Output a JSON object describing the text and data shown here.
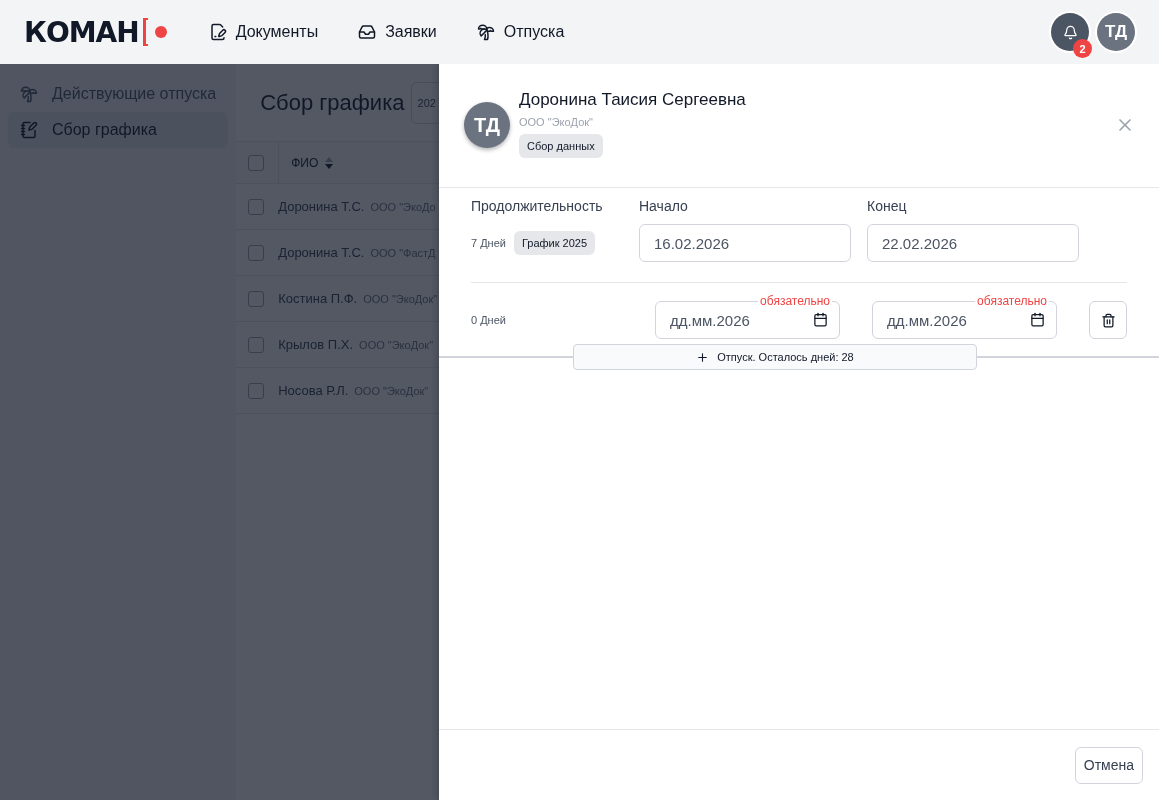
{
  "header": {
    "logo": "КОМАН",
    "nav": [
      {
        "label": "Документы"
      },
      {
        "label": "Заявки"
      },
      {
        "label": "Отпуска"
      }
    ],
    "notifications": {
      "count": "2"
    },
    "user": {
      "initials": "ТД"
    }
  },
  "sidebar": {
    "items": [
      {
        "label": "Действующие отпуска",
        "selected": false
      },
      {
        "label": "Сбор графика",
        "selected": true
      }
    ]
  },
  "page": {
    "title": "Сбор графика",
    "year_select": "202",
    "table": {
      "all_checked": false,
      "columns": [
        {
          "label": "ФИО",
          "sort_descending": true
        }
      ],
      "rows": [
        {
          "name": "Доронина Т.С.",
          "company": "ООО \"ЭкоДо",
          "checked": false
        },
        {
          "name": "Доронина Т.С.",
          "company": "ООО \"ФастД",
          "checked": false
        },
        {
          "name": "Костина П.Ф.",
          "company": "ООО \"ЭкоДок\"",
          "checked": false
        },
        {
          "name": "Крылов П.Х.",
          "company": "ООО \"ЭкоДок\"",
          "checked": false
        },
        {
          "name": "Носова Р.Л.",
          "company": "ООО \"ЭкоДок\"",
          "checked": false
        }
      ]
    }
  },
  "drawer": {
    "initials": "ТД",
    "name": "Доронина Таисия Сергеевна",
    "company": "ООО \"ЭкоДок\"",
    "status": "Сбор данных",
    "labels": {
      "duration": "Продолжительность",
      "start": "Начало",
      "end": "Конец"
    },
    "periods": [
      {
        "days": "7 Дней",
        "tag": "График 2025",
        "start": {
          "value": "16.02.2026",
          "kind": "text"
        },
        "end": {
          "value": "22.02.2026",
          "kind": "text"
        },
        "deletable": false
      },
      {
        "days": "0 Дней",
        "start": {
          "placeholder": "дд.мм.2026",
          "kind": "date",
          "error": "обязательно"
        },
        "end": {
          "placeholder": "дд.мм.2026",
          "kind": "date",
          "error": "обязательно"
        },
        "deletable": true
      }
    ],
    "add_button": "Отпуск. Осталось дней: 28",
    "cancel_button": "Отмена"
  }
}
